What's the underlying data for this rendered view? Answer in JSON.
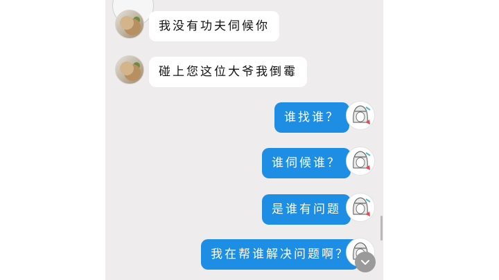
{
  "messages": [
    {
      "side": "in",
      "text": "我没有功夫伺候你"
    },
    {
      "side": "in",
      "text": "碰上您这位大爷我倒霉"
    },
    {
      "side": "out",
      "text": "谁找谁？"
    },
    {
      "side": "out",
      "text": "谁伺候谁？"
    },
    {
      "side": "out",
      "text": "是谁有问题"
    },
    {
      "side": "out",
      "text": "我在帮谁解决问题啊？"
    }
  ],
  "icons": {
    "scroll_down": "chevron-down-icon",
    "incoming_avatar": "cat-avatar",
    "outgoing_avatar": "girl-avatar"
  },
  "colors": {
    "chat_background": "#eeeced",
    "incoming_bubble": "#ffffff",
    "outgoing_bubble": "#1d8ee3"
  }
}
